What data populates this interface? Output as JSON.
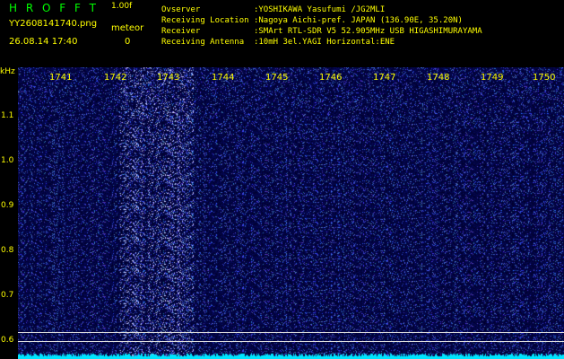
{
  "header": {
    "app_title": "H R O F F T",
    "version": "1.00f",
    "filename": "YY2608141740.png",
    "meteor_label": "meteor",
    "datetime": "26.08.14 17:40",
    "meteor_count": "0"
  },
  "station_info": [
    "Ovserver           :YOSHIKAWA Yasufumi /JG2MLI",
    "Receiving Location :Nagoya Aichi-pref. JAPAN (136.90E, 35.20N)",
    "Receiver           :SMArt RTL-SDR V5 52.905MHz USB HIGASHIMURAYAMA",
    "Receiving Antenna  :10mH 3el.YAGI Horizontal:ENE"
  ],
  "spectrogram": {
    "y_unit": "kHz",
    "y_ticks": [
      "1.1",
      "1.0",
      "0.9",
      "0.8",
      "0.7",
      "0.6"
    ],
    "x_ticks": [
      "1741",
      "1742",
      "1743",
      "1744",
      "1745",
      "1746",
      "1747",
      "1748",
      "1749",
      "1750"
    ],
    "colors": {
      "background": "#02023a",
      "noise": "#1f2fb8",
      "bright_noise": "#6f8cff",
      "baseline": "#00e5ff"
    }
  }
}
